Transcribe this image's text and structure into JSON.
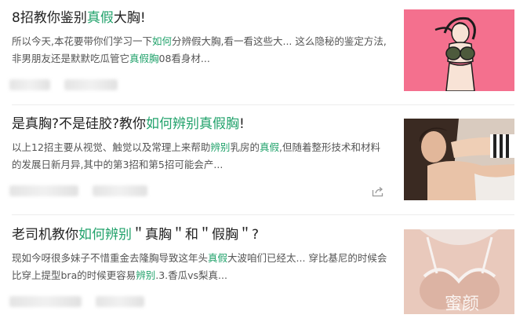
{
  "results": [
    {
      "title": [
        "8招教你鉴别",
        {
          "hl": "真假"
        },
        "大胸!"
      ],
      "snippet": [
        "所以今天,本花要带你们学习一下",
        {
          "hl": "如何"
        },
        "分辨假大胸,看一看这些大... 这么隐秘的鉴定方法,非男朋友还是默默吃瓜管它",
        {
          "hl": "真假胸"
        },
        "08看身材..."
      ],
      "thumbnail": "cartoon-woman-illustration"
    },
    {
      "title": [
        "是真胸?不是硅胶?教你",
        {
          "hl": "如何辨别真假胸"
        },
        "!"
      ],
      "snippet": [
        "以上12招主要从视觉、触觉以及常理上来帮助",
        {
          "hl": "辨别"
        },
        "乳房的",
        {
          "hl": "真假"
        },
        ",但随着整形技术和材料的发展日新月异,其中的第3招和第5招可能会产..."
      ],
      "thumbnail": "woman-photo"
    },
    {
      "title": [
        "老司机教你",
        {
          "hl": "如何辨别"
        },
        "＂真胸＂和＂假胸＂?"
      ],
      "snippet": [
        "现如今呀很多妹子不惜重金去隆胸导致这年头",
        {
          "hl": "真假"
        },
        "大波咱们已经太... 穿比基尼的时候会比穿上提型bra的时候更容易",
        {
          "hl": "辨别"
        },
        ".3.香瓜vs梨真..."
      ],
      "thumbnail": "chest-photo"
    }
  ],
  "watermark": "蜜颜",
  "colors": {
    "highlight": "#21a26b",
    "title": "#222222",
    "snippet": "#555555",
    "divider": "#ececec"
  }
}
